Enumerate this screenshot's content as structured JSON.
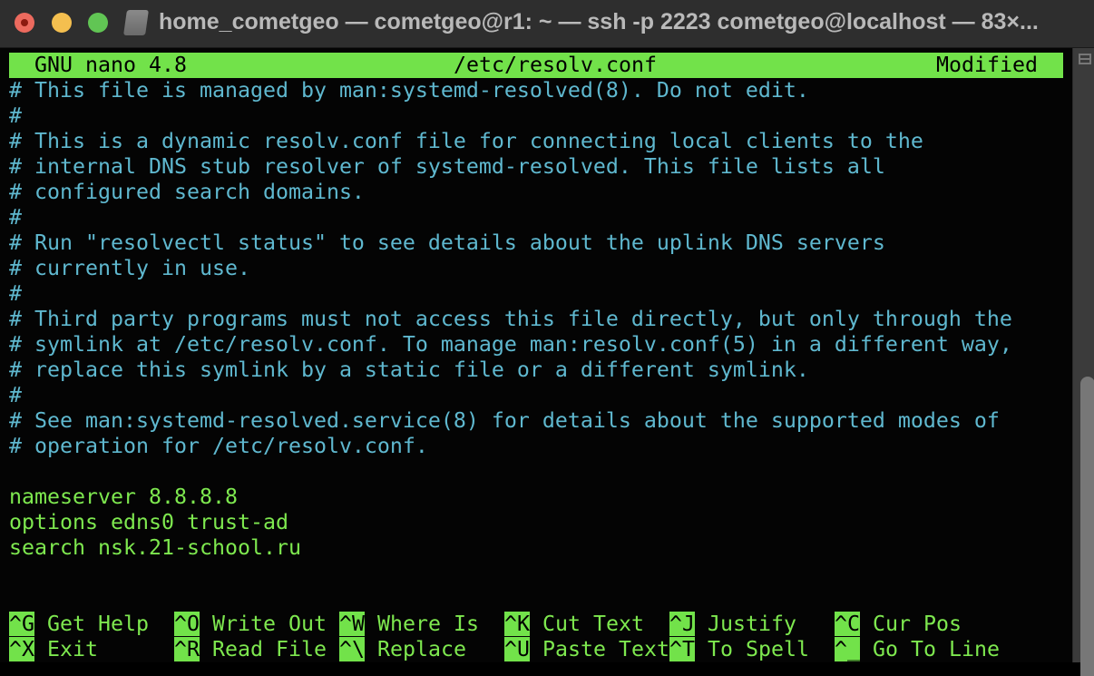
{
  "window": {
    "title": "home_cometgeo — cometgeo@r1: ~ — ssh -p 2223 cometgeo@localhost — 83×...",
    "icon": "disk-icon"
  },
  "nano": {
    "version": "GNU nano 4.8",
    "filename": "/etc/resolv.conf",
    "status": "Modified"
  },
  "lines": [
    {
      "text": "# This file is managed by man:systemd-resolved(8). Do not edit.",
      "type": "comment"
    },
    {
      "text": "#",
      "type": "comment"
    },
    {
      "text": "# This is a dynamic resolv.conf file for connecting local clients to the",
      "type": "comment"
    },
    {
      "text": "# internal DNS stub resolver of systemd-resolved. This file lists all",
      "type": "comment"
    },
    {
      "text": "# configured search domains.",
      "type": "comment"
    },
    {
      "text": "#",
      "type": "comment"
    },
    {
      "text": "# Run \"resolvectl status\" to see details about the uplink DNS servers",
      "type": "comment"
    },
    {
      "text": "# currently in use.",
      "type": "comment"
    },
    {
      "text": "#",
      "type": "comment"
    },
    {
      "text": "# Third party programs must not access this file directly, but only through the",
      "type": "comment"
    },
    {
      "text": "# symlink at /etc/resolv.conf. To manage man:resolv.conf(5) in a different way,",
      "type": "comment"
    },
    {
      "text": "# replace this symlink by a static file or a different symlink.",
      "type": "comment"
    },
    {
      "text": "#",
      "type": "comment"
    },
    {
      "text": "# See man:systemd-resolved.service(8) for details about the supported modes of",
      "type": "comment"
    },
    {
      "text": "# operation for /etc/resolv.conf.",
      "type": "comment"
    },
    {
      "text": "",
      "type": "blank"
    },
    {
      "text": "nameserver 8.8.8.8",
      "type": "config"
    },
    {
      "text": "options edns0 trust-ad",
      "type": "config"
    },
    {
      "text": "search nsk.21-school.ru",
      "type": "config"
    }
  ],
  "shortcuts": [
    [
      {
        "key": "^G",
        "label": "Get Help"
      },
      {
        "key": "^O",
        "label": "Write Out"
      },
      {
        "key": "^W",
        "label": "Where Is"
      },
      {
        "key": "^K",
        "label": "Cut Text"
      },
      {
        "key": "^J",
        "label": "Justify"
      },
      {
        "key": "^C",
        "label": "Cur Pos"
      }
    ],
    [
      {
        "key": "^X",
        "label": "Exit"
      },
      {
        "key": "^R",
        "label": "Read File"
      },
      {
        "key": "^\\",
        "label": "Replace"
      },
      {
        "key": "^U",
        "label": "Paste Text"
      },
      {
        "key": "^T",
        "label": "To Spell"
      },
      {
        "key": "^_",
        "label": "Go To Line"
      }
    ]
  ],
  "colors": {
    "header_bg": "#72e24a",
    "comment": "#5fb8cf",
    "config": "#7ee84f",
    "background": "#040404"
  }
}
